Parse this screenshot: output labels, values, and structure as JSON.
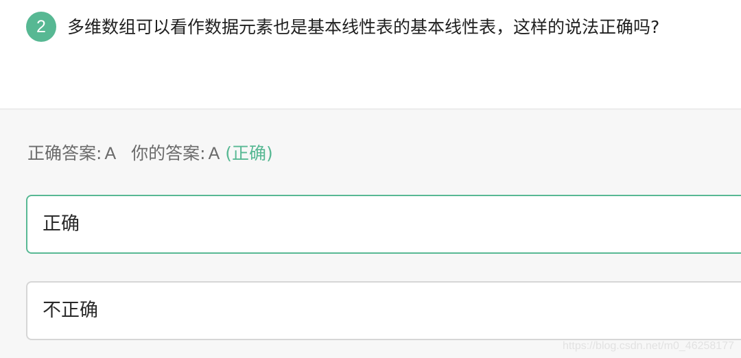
{
  "question": {
    "number": "2",
    "text": "多维数组可以看作数据元素也是基本线性表的基本线性表，这样的说法正确吗?"
  },
  "result": {
    "correct_label": "正确答案:",
    "correct_value": "A",
    "your_label": "你的答案:",
    "your_value": "A",
    "verdict": "(正确)"
  },
  "options": [
    {
      "label": "正确",
      "selected": true
    },
    {
      "label": "不正确",
      "selected": false
    }
  ],
  "watermark": "https://blog.csdn.net/m0_46258177",
  "colors": {
    "accent": "#57b893",
    "muted_text": "#6b6b6b",
    "answer_background": "#f7f7f7"
  }
}
